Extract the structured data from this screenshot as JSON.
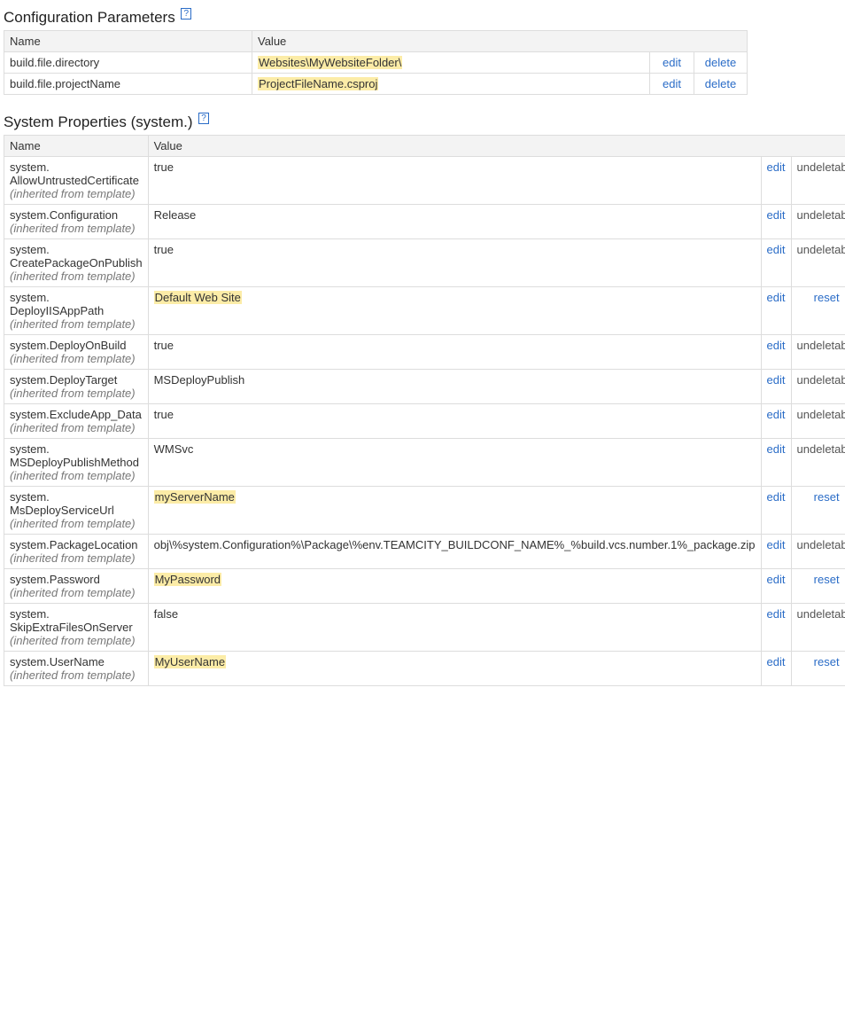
{
  "config_section": {
    "title": "Configuration Parameters",
    "help": "?",
    "headers": {
      "name": "Name",
      "value": "Value"
    },
    "rows": [
      {
        "name": "build.file.directory",
        "value": "Websites\\MyWebsiteFolder\\",
        "highlight": true,
        "a1": "edit",
        "a2": "delete"
      },
      {
        "name": "build.file.projectName",
        "value": "ProjectFileName.csproj",
        "highlight": true,
        "a1": "edit",
        "a2": "delete"
      }
    ]
  },
  "system_section": {
    "title": "System Properties (system.)",
    "help": "?",
    "headers": {
      "name": "Name",
      "value": "Value"
    },
    "inherited_label": "(inherited from template)",
    "rows": [
      {
        "name": "system.\nAllowUntrustedCertificate",
        "value": "true",
        "highlight": false,
        "a1": "edit",
        "a2": "undeletable",
        "a2link": false
      },
      {
        "name": "system.Configuration",
        "value": "Release",
        "highlight": false,
        "a1": "edit",
        "a2": "undeletable",
        "a2link": false
      },
      {
        "name": "system.\nCreatePackageOnPublish",
        "value": "true",
        "highlight": false,
        "a1": "edit",
        "a2": "undeletable",
        "a2link": false
      },
      {
        "name": "system.\nDeployIISAppPath",
        "value": "Default Web Site",
        "highlight": true,
        "a1": "edit",
        "a2": "reset",
        "a2link": true
      },
      {
        "name": "system.DeployOnBuild",
        "value": "true",
        "highlight": false,
        "a1": "edit",
        "a2": "undeletable",
        "a2link": false
      },
      {
        "name": "system.DeployTarget",
        "value": "MSDeployPublish",
        "highlight": false,
        "a1": "edit",
        "a2": "undeletable",
        "a2link": false
      },
      {
        "name": "system.ExcludeApp_Data",
        "value": "true",
        "highlight": false,
        "a1": "edit",
        "a2": "undeletable",
        "a2link": false
      },
      {
        "name": "system.\nMSDeployPublishMethod",
        "value": "WMSvc",
        "highlight": false,
        "a1": "edit",
        "a2": "undeletable",
        "a2link": false
      },
      {
        "name": "system.\nMsDeployServiceUrl",
        "value": "myServerName",
        "highlight": true,
        "a1": "edit",
        "a2": "reset",
        "a2link": true
      },
      {
        "name": "system.PackageLocation",
        "value": "obj\\%system.Configuration%\\Package\\%env.TEAMCITY_BUILDCONF_NAME%_%build.vcs.number.1%_package.zip",
        "highlight": false,
        "a1": "edit",
        "a2": "undeletable",
        "a2link": false
      },
      {
        "name": "system.Password",
        "value": "MyPassword",
        "highlight": true,
        "a1": "edit",
        "a2": "reset",
        "a2link": true
      },
      {
        "name": "system.\nSkipExtraFilesOnServer",
        "value": "false",
        "highlight": false,
        "a1": "edit",
        "a2": "undeletable",
        "a2link": false
      },
      {
        "name": "system.UserName",
        "value": "MyUserName",
        "highlight": true,
        "a1": "edit",
        "a2": "reset",
        "a2link": true
      }
    ]
  }
}
